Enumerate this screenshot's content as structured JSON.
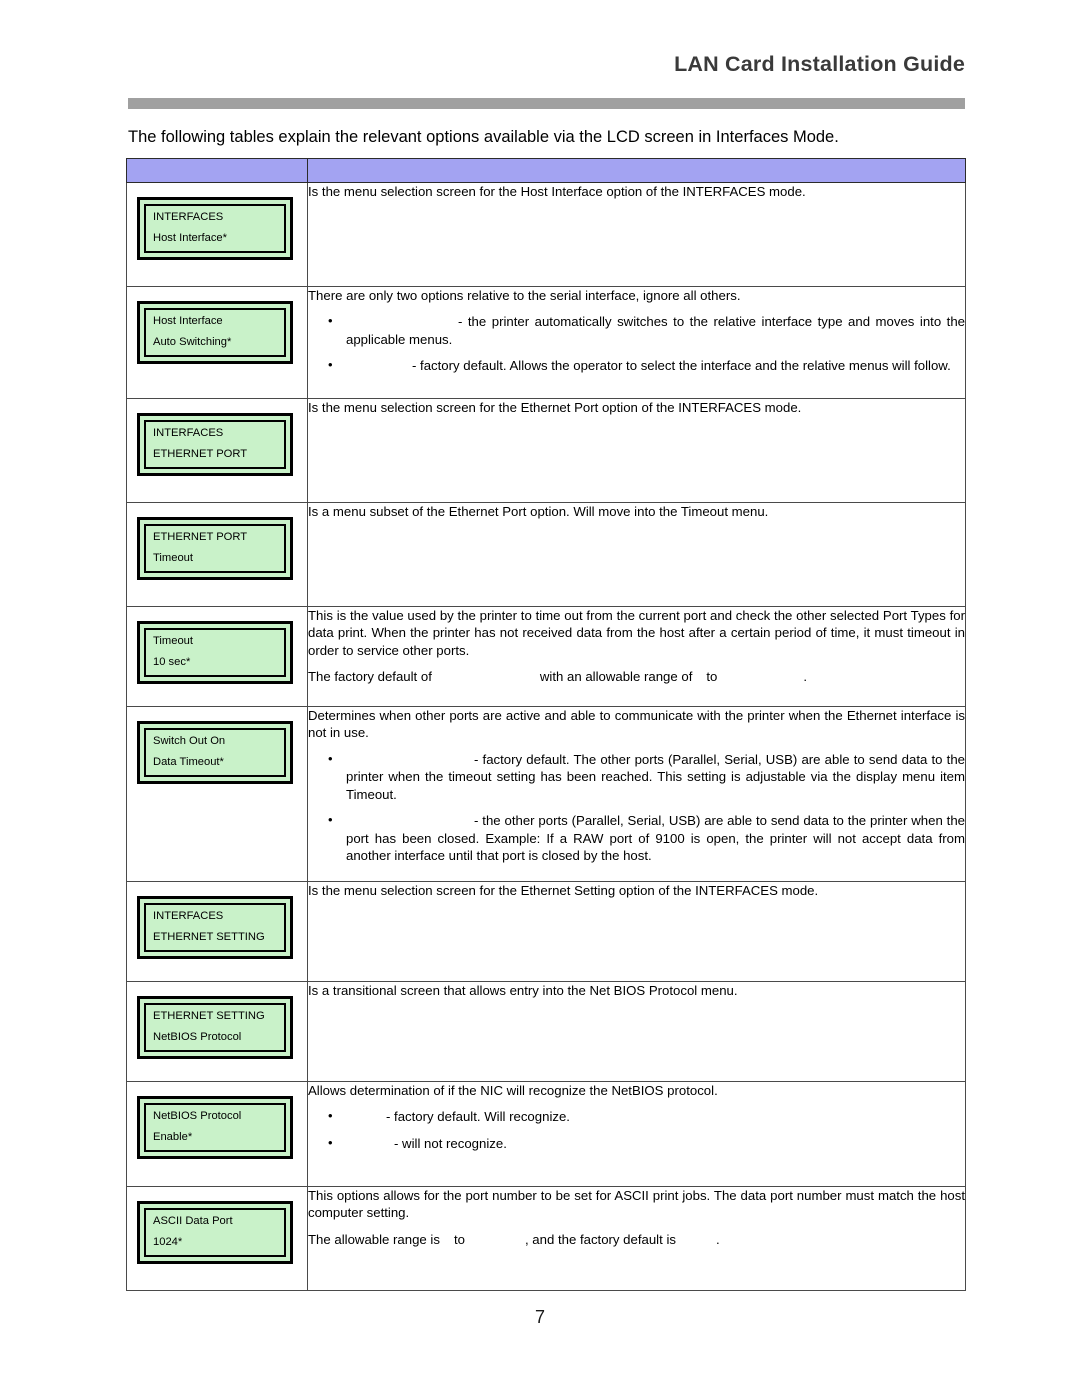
{
  "document": {
    "header_title": "LAN Card Installation Guide",
    "intro": "The following tables explain the relevant options available via the LCD screen in Interfaces Mode.",
    "page_number": "7"
  },
  "table": {
    "header": {
      "col1": "",
      "col2": ""
    },
    "rows": [
      {
        "lcd": {
          "line1": "INTERFACES",
          "line2": "Host Interface*"
        },
        "desc": {
          "paras": [
            "Is the menu selection screen for the Host Interface option of the INTERFACES mode."
          ],
          "bullets": []
        }
      },
      {
        "lcd": {
          "line1": "Host Interface",
          "line2": "Auto Switching*"
        },
        "desc": {
          "paras": [
            "There are only two options relative to the serial interface, ignore all others."
          ],
          "bullets": [
            {
              "term": "",
              "term_width": 112,
              "text": "- the printer automatically switches to the relative interface type and moves into the applicable menus."
            },
            {
              "term": "",
              "term_width": 66,
              "text": "- factory default. Allows the operator to select the interface and the relative menus will follow."
            }
          ]
        }
      },
      {
        "lcd": {
          "line1": "INTERFACES",
          "line2": "ETHERNET PORT"
        },
        "desc": {
          "paras": [
            "Is the menu selection screen for the Ethernet Port option of the INTERFACES mode."
          ],
          "bullets": []
        }
      },
      {
        "lcd": {
          "line1": "ETHERNET PORT",
          "line2": "Timeout"
        },
        "desc": {
          "paras": [
            "Is a menu subset of the Ethernet Port option. Will move into the Timeout menu."
          ],
          "bullets": []
        }
      },
      {
        "lcd": {
          "line1": "Timeout",
          "line2": "10  sec*"
        },
        "desc": {
          "paras": [
            "This is the value used by the printer to time out from the current port and check the other selected Port Types for data print. When the printer has not received data from the host after a certain period of time, it must timeout in order to service other ports."
          ],
          "split_para": {
            "a": "The factory default of",
            "gap1": 108,
            "b": "with an allowable range of",
            "gap2": 14,
            "c": "to",
            "gap3": 86,
            "d": "."
          },
          "bullets": []
        }
      },
      {
        "lcd": {
          "line1": "Switch Out On",
          "line2": "Data Timeout*"
        },
        "desc": {
          "paras": [
            "Determines when other ports are active and able to communicate with the printer when the Ethernet interface is not in use."
          ],
          "bullets": [
            {
              "term": "",
              "term_width": 128,
              "text": "- factory default. The other ports (Parallel, Serial, USB) are able to send data to the printer when the timeout setting has been reached. This setting is adjustable via the display menu item Timeout."
            },
            {
              "term": "",
              "term_width": 128,
              "text": "- the other ports (Parallel, Serial, USB) are able to send data to the printer when the port has been closed. Example: If a RAW port of 9100 is open, the printer will not accept data from another interface until that port is closed by the host."
            }
          ]
        }
      },
      {
        "lcd": {
          "line1": "INTERFACES",
          "line2": "ETHERNET SETTING"
        },
        "desc": {
          "paras": [
            "Is the menu selection screen for the Ethernet Setting option of the INTERFACES mode."
          ],
          "bullets": []
        }
      },
      {
        "lcd": {
          "line1": "ETHERNET SETTING",
          "line2": "NetBIOS Protocol"
        },
        "desc": {
          "paras": [
            "Is a transitional screen that allows entry into the Net BIOS Protocol menu."
          ],
          "bullets": []
        }
      },
      {
        "lcd": {
          "line1": "NetBIOS Protocol",
          "line2": "Enable*"
        },
        "desc": {
          "paras": [
            "Allows determination of if the NIC will recognize the NetBIOS protocol."
          ],
          "bullets": [
            {
              "term": "",
              "term_width": 40,
              "text": "-  factory default. Will recognize."
            },
            {
              "term": "",
              "term_width": 48,
              "text": "- will not recognize."
            }
          ]
        }
      },
      {
        "lcd": {
          "line1": "ASCII Data Port",
          "line2": "1024*"
        },
        "desc": {
          "paras": [
            "This options allows for the port number to be set for ASCII print jobs. The data port number must match the host computer setting."
          ],
          "split_para": {
            "a": "The allowable range is",
            "gap1": 14,
            "b": "to",
            "gap2": 60,
            "c": ", and the factory default is",
            "gap3": 40,
            "d": "."
          },
          "bullets": []
        }
      }
    ]
  },
  "colors": {
    "header_rule": "#a0a0a0",
    "table_header_fill": "#a3a3f2",
    "lcd_fill": "#c9f2c9",
    "lcd_border": "#000000",
    "table_border": "#4a4a4a"
  }
}
